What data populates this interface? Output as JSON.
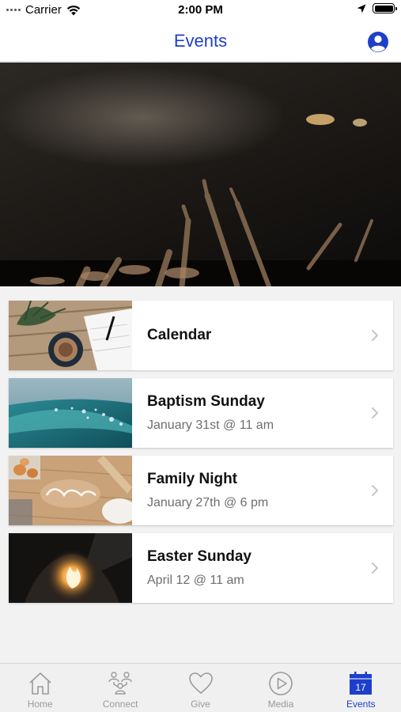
{
  "status_bar": {
    "carrier": "Carrier",
    "time": "2:00 PM"
  },
  "nav": {
    "title": "Events"
  },
  "events": [
    {
      "title": "Calendar",
      "subtitle": "",
      "thumb": "desk-notebook-coffee"
    },
    {
      "title": "Baptism Sunday",
      "subtitle": "January 31st @ 11 am",
      "thumb": "water-wave"
    },
    {
      "title": "Family Night",
      "subtitle": "January 27th @ 6 pm",
      "thumb": "baking-family-flour"
    },
    {
      "title": "Easter Sunday",
      "subtitle": "April 12 @ 11 am",
      "thumb": "fire-in-tomb"
    }
  ],
  "tabs": [
    {
      "label": "Home",
      "icon": "home-icon"
    },
    {
      "label": "Connect",
      "icon": "people-icon"
    },
    {
      "label": "Give",
      "icon": "heart-icon"
    },
    {
      "label": "Media",
      "icon": "play-icon"
    },
    {
      "label": "Events",
      "icon": "calendar-icon",
      "active": true,
      "calendar_day": "17"
    }
  ],
  "colors": {
    "accent": "#1d3fc9",
    "tab_inactive": "#9a9a9a",
    "background": "#f2f2f2"
  }
}
